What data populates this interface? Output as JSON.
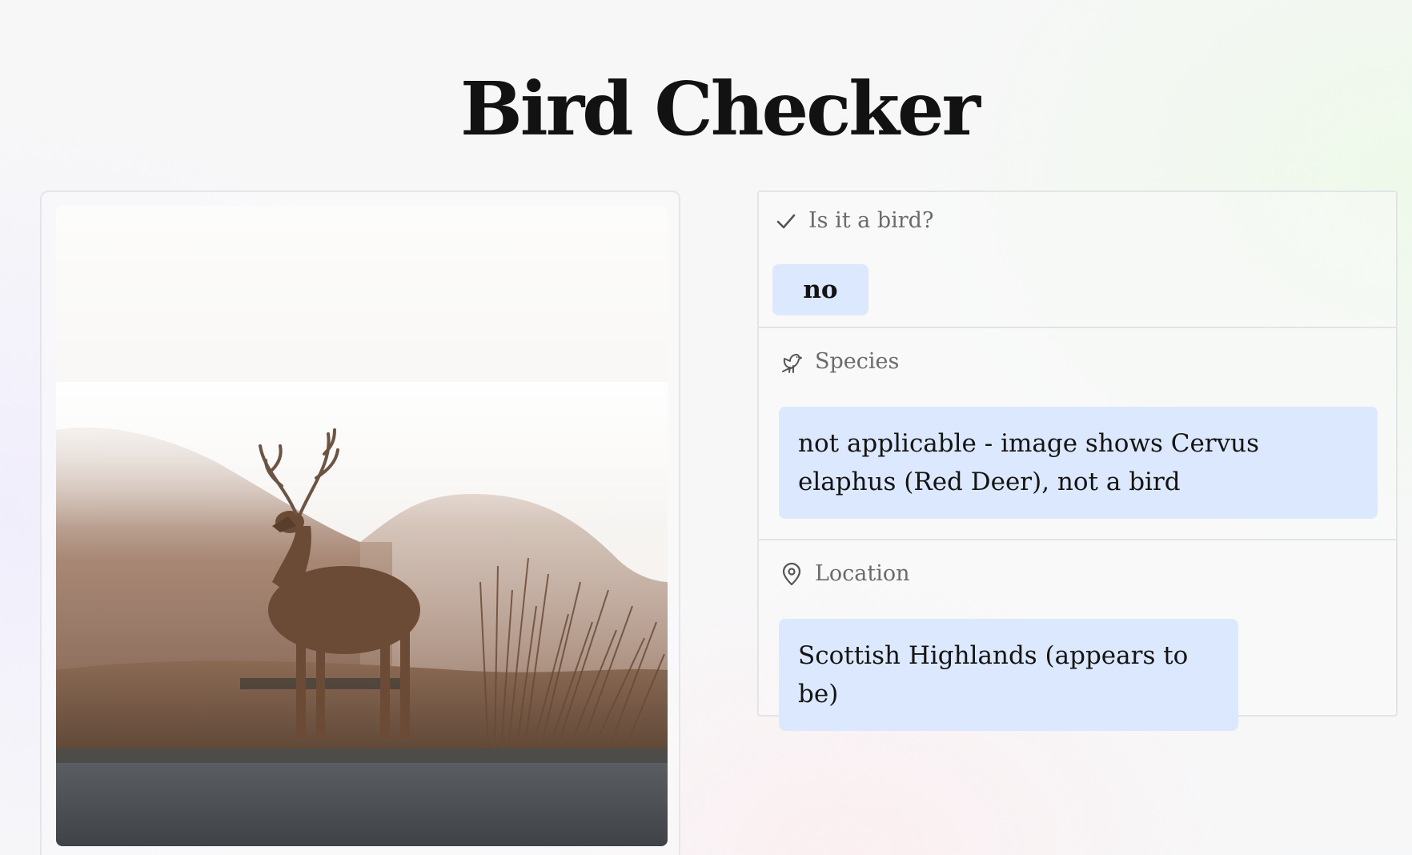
{
  "header": {
    "title": "Bird Checker"
  },
  "photo": {
    "subject": "red-deer-stag-in-highlands"
  },
  "results": {
    "is_bird": {
      "label": "Is it a bird?",
      "value": "no",
      "icon": "check-icon"
    },
    "species": {
      "label": "Species",
      "value": "not applicable - image shows Cervus elaphus (Red Deer), not a bird",
      "icon": "bird-icon"
    },
    "location": {
      "label": "Location",
      "value": "Scottish Highlands (appears to be)",
      "icon": "map-pin-icon"
    }
  },
  "colors": {
    "pill_bg": "#dce8fd",
    "label_text": "#6b6b6b",
    "title_text": "#121212"
  }
}
